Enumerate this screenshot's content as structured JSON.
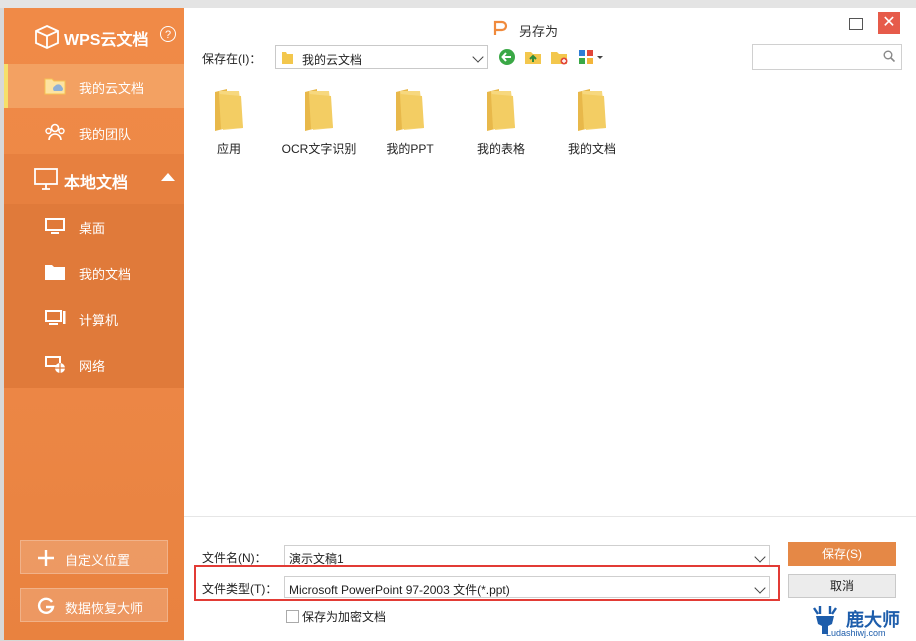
{
  "sidebar": {
    "brand": "WPS云文档",
    "help": "?",
    "items": [
      {
        "label": "我的云文档"
      },
      {
        "label": "我的团队"
      }
    ],
    "local_section": "本地文档",
    "local_items": [
      {
        "label": "桌面"
      },
      {
        "label": "我的文档"
      },
      {
        "label": "计算机"
      },
      {
        "label": "网络"
      }
    ],
    "custom_location": "自定义位置",
    "data_recovery": "数据恢复大师"
  },
  "dialog": {
    "title": "另存为",
    "close": "✕"
  },
  "toolbar": {
    "save_in_label": "保存在(I)：",
    "location": "我的云文档",
    "search_placeholder": ""
  },
  "files": [
    {
      "name": "应用"
    },
    {
      "name": "OCR文字识别"
    },
    {
      "name": "我的PPT"
    },
    {
      "name": "我的表格"
    },
    {
      "name": "我的文档"
    }
  ],
  "bottom": {
    "filename_label": "文件名(N)：",
    "filename_value": "演示文稿1",
    "filetype_label": "文件类型(T)：",
    "filetype_value": "Microsoft PowerPoint 97-2003 文件(*.ppt)",
    "save_button": "保存(S)",
    "cancel_button": "取消",
    "encrypt_label": "保存为加密文档"
  },
  "watermark": {
    "title": "鹿大师",
    "url": "Ludashiwj.com"
  },
  "colors": {
    "sidebar": "#ec8746",
    "accent": "#e58846",
    "highlight_border": "#e23b35",
    "folder": "#f3d57a"
  }
}
